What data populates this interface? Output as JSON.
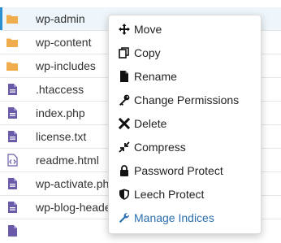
{
  "files": [
    {
      "name": "wp-admin",
      "icon": "folder-icon",
      "selected": true
    },
    {
      "name": "wp-content",
      "icon": "folder-icon"
    },
    {
      "name": "wp-includes",
      "icon": "folder-icon"
    },
    {
      "name": ".htaccess",
      "icon": "text-file-icon"
    },
    {
      "name": "index.php",
      "icon": "text-file-icon"
    },
    {
      "name": "license.txt",
      "icon": "text-file-icon"
    },
    {
      "name": "readme.html",
      "icon": "code-file-icon"
    },
    {
      "name": "wp-activate.php",
      "icon": "text-file-icon"
    },
    {
      "name": "wp-blog-header.php",
      "icon": "text-file-icon"
    },
    {
      "name": "",
      "icon": "text-file-icon"
    }
  ],
  "context_menu": {
    "items": [
      {
        "label": "Move",
        "icon": "move-icon"
      },
      {
        "label": "Copy",
        "icon": "copy-icon"
      },
      {
        "label": "Rename",
        "icon": "file-icon"
      },
      {
        "label": "Change Permissions",
        "icon": "key-icon"
      },
      {
        "label": "Delete",
        "icon": "close-icon"
      },
      {
        "label": "Compress",
        "icon": "compress-icon"
      },
      {
        "label": "Password Protect",
        "icon": "lock-icon"
      },
      {
        "label": "Leech Protect",
        "icon": "shield-icon"
      },
      {
        "label": "Manage Indices",
        "icon": "wrench-icon",
        "highlight": true
      }
    ]
  },
  "colors": {
    "folder": "#f0ad4e",
    "file": "#6a5aa8",
    "accent": "#2b8fd1",
    "link": "#2a6fb0"
  }
}
